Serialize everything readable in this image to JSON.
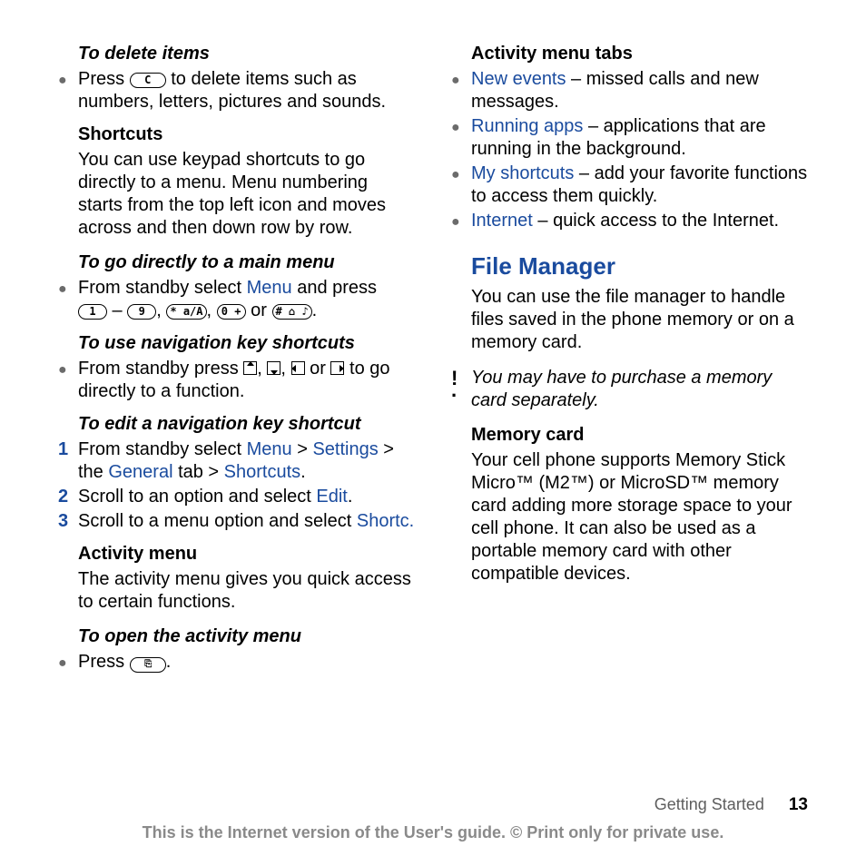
{
  "left": {
    "delete": {
      "heading": "To delete items",
      "bullet_pre": "Press ",
      "bullet_post": " to delete items such as numbers, letters, pictures and sounds.",
      "key_c": "C"
    },
    "shortcuts": {
      "heading": "Shortcuts",
      "para": "You can use keypad shortcuts to go directly to a menu. Menu numbering starts from the top left icon and moves across and then down row by row."
    },
    "mainmenu": {
      "heading": "To go directly to a main menu",
      "bullet_pre": "From standby select ",
      "menu_link": "Menu",
      "bullet_mid": " and press ",
      "dash": " – ",
      "comma": ", ",
      "or": " or ",
      "period": ".",
      "key1": "1",
      "key9": "9",
      "keystar": "* a/A",
      "key0": "0 +",
      "keyhash": "# ⌂ ♪"
    },
    "navshort": {
      "heading": "To use navigation key shortcuts",
      "bullet_pre": "From standby press ",
      "comma": ", ",
      "or": " or ",
      "bullet_post": " to go directly to a function."
    },
    "editnav": {
      "heading": "To edit a navigation key shortcut",
      "step1_num": "1",
      "step1_pre": "From standby select ",
      "step1_menu": "Menu",
      "step1_gt1": " > ",
      "step1_settings": "Settings",
      "step1_gt2": " > the ",
      "step1_general": "General",
      "step1_tab": " tab > ",
      "step1_shortcuts": "Shortcuts",
      "step1_period": ".",
      "step2_num": "2",
      "step2_pre": "Scroll to an option and select ",
      "step2_edit": "Edit",
      "step2_period": ".",
      "step3_num": "3",
      "step3_pre": "Scroll to a menu option and select ",
      "step3_shortc": "Shortc.",
      "step3_blank": ""
    },
    "activitymenu": {
      "heading": "Activity menu",
      "para": "The activity menu gives you quick access to certain functions."
    },
    "openactivity": {
      "heading": "To open the activity menu",
      "bullet_pre": "Press ",
      "period": ".",
      "key_act": "⎘"
    }
  },
  "right": {
    "tabs": {
      "heading": "Activity menu tabs",
      "items": [
        {
          "link": "New events",
          "rest": " – missed calls and new messages."
        },
        {
          "link": "Running apps",
          "rest": " – applications that are running in the background."
        },
        {
          "link": "My shortcuts",
          "rest": " – add your favorite functions to access them quickly."
        },
        {
          "link": "Internet",
          "rest": " – quick access to the Internet."
        }
      ]
    },
    "filemgr": {
      "heading": "File Manager",
      "para": "You can use the file manager to handle files saved in the phone memory or on a memory card."
    },
    "note": {
      "icon": "!",
      "text": "You may have to purchase a memory card separately."
    },
    "memcard": {
      "heading": "Memory card",
      "para": "Your cell phone supports Memory Stick Micro™ (M2™) or MicroSD™ memory card adding more storage space to your cell phone. It can also be used as a portable memory card with other compatible devices."
    }
  },
  "footer": {
    "section": "Getting Started",
    "page": "13",
    "disclaimer": "This is the Internet version of the User's guide. © Print only for private use."
  }
}
